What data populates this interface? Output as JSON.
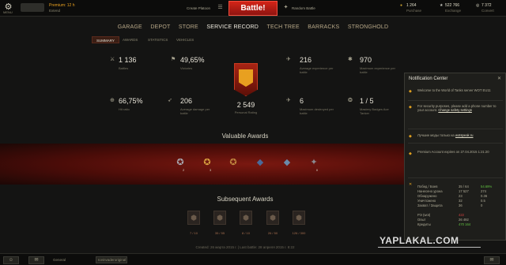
{
  "topbar": {
    "menu_icon": "gear-icon",
    "menu_label": "MENU",
    "premium_text": "Premium: 12 h",
    "premium_sub": "Extend",
    "create_platoon": "Create Platoon",
    "battle_label": "Battle!",
    "battle_mode": "Random Battle",
    "resources": [
      {
        "icon": "gold-icon",
        "value": "1 264",
        "label": "Purchase"
      },
      {
        "icon": "xp-icon",
        "value": "522 766",
        "label": "Exchange"
      },
      {
        "icon": "credits-icon",
        "value": "7 372",
        "label": "Convert"
      }
    ]
  },
  "nav": [
    "GARAGE",
    "DEPOT",
    "STORE",
    "SERVICE RECORD",
    "TECH TREE",
    "BARRACKS",
    "STRONGHOLD"
  ],
  "nav_active": "SERVICE RECORD",
  "tabs": [
    "SUMMARY",
    "AWARDS",
    "STATISTICS",
    "VEHICLES"
  ],
  "stats": {
    "battles": {
      "value": "1 136",
      "label": "Battles"
    },
    "victories": {
      "value": "49,65%",
      "label": "Victories"
    },
    "avg_exp": {
      "value": "216",
      "label": "Average experience per battle"
    },
    "max_exp": {
      "value": "970",
      "label": "Maximum experience per battle"
    },
    "hit_ratio": {
      "value": "66,75%",
      "label": "Hit ratio"
    },
    "avg_damage": {
      "value": "206",
      "label": "Average damage per battle"
    },
    "max_destroyed": {
      "value": "6",
      "label": "Maximum destroyed per battle"
    },
    "mastery": {
      "value": "1 / 5",
      "label": "Mastery Badges Ace Tanker"
    },
    "rating": {
      "value": "2 549",
      "label": "Personal Rating"
    }
  },
  "valuable": {
    "title": "Valuable Awards",
    "items": [
      {
        "name": "medal-icon",
        "glyph": "✪",
        "color": "#a8a8b0",
        "count": "2"
      },
      {
        "name": "medal-icon",
        "glyph": "✪",
        "color": "#d8a040",
        "count": "3"
      },
      {
        "name": "medal-icon",
        "glyph": "✪",
        "color": "#c08840",
        "count": ""
      },
      {
        "name": "medal-icon",
        "glyph": "◆",
        "color": "#4a6a9a",
        "count": ""
      },
      {
        "name": "medal-icon",
        "glyph": "◆",
        "color": "#6a8aaa",
        "count": ""
      },
      {
        "name": "medal-icon",
        "glyph": "✦",
        "color": "#8a8a90",
        "count": "II"
      }
    ]
  },
  "subsequent": {
    "title": "Subsequent Awards",
    "items": [
      {
        "name": "award-icon",
        "count": "7 / 10"
      },
      {
        "name": "award-icon",
        "count": "35 / 55"
      },
      {
        "name": "award-icon",
        "count": "8 / 10"
      },
      {
        "name": "award-icon",
        "count": "26 / 50"
      },
      {
        "name": "award-icon",
        "count": "126 / 300"
      }
    ]
  },
  "footer_dates": "Created: 26 марта 2015 г. | Last battle: 28 апреля 2015 г. 8:22",
  "notifications": {
    "title": "Notification Center",
    "items": [
      {
        "text": "Welcome to the World of Tanks server WOT EU11"
      },
      {
        "text": "For security purposes, please add a phone number to your account.",
        "link": "Change safety settings"
      },
      {
        "text": "Лучшие моды только на",
        "link": "wotspeak.ru"
      },
      {
        "text": "Premium Account expires on 27.04.2015 1:21:20"
      }
    ],
    "summary": [
      [
        "Побед / Боев",
        "35 / 64",
        "54.69%"
      ],
      [
        "Нанесено урона",
        "17 527",
        "274"
      ],
      [
        "Обнаружено",
        "23",
        "0.36"
      ],
      [
        "Уничтожено",
        "32",
        "0.5"
      ],
      [
        "Захват / Защита",
        "36",
        "0"
      ],
      [
        "РЭ (wot)",
        "422",
        ""
      ],
      [
        "Опыт",
        "26 492",
        ""
      ],
      [
        "Кредиты",
        "470 164",
        ""
      ]
    ]
  },
  "bottombar": {
    "channel": "General",
    "channel2": "Iceinvaderoriginal"
  },
  "watermark": "YAPLAKAL.COM"
}
